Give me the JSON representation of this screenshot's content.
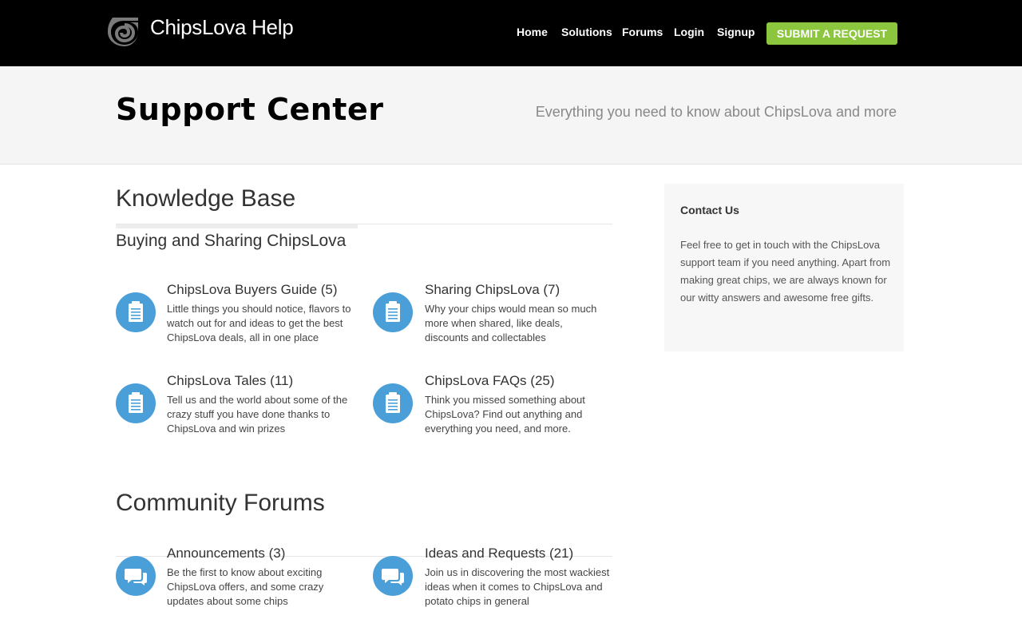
{
  "header": {
    "brand": "ChipsLova Help",
    "nav": [
      "Home",
      "Solutions",
      "Forums",
      "Login",
      "Signup"
    ],
    "submit_label": "SUBMIT A REQUEST",
    "accent_color": "#8cc63e"
  },
  "hero": {
    "title": "Support Center",
    "tagline": "Everything you need to know about ChipsLova and more"
  },
  "knowledge_base": {
    "title": "Knowledge Base",
    "category": "Buying and Sharing ChipsLova",
    "items": [
      {
        "title": "ChipsLova Buyers Guide (5)",
        "desc": "Little things you should notice, flavors to watch out for and ideas to get the best ChipsLova deals, all in one place",
        "icon": "clipboard-icon"
      },
      {
        "title": "Sharing ChipsLova (7)",
        "desc": "Why your chips would mean so much more when shared, like deals, discounts and collectables",
        "icon": "clipboard-icon"
      },
      {
        "title": "ChipsLova Tales (11)",
        "desc": "Tell us and the world about some of the crazy stuff you have done thanks to ChipsLova and win prizes",
        "icon": "clipboard-icon"
      },
      {
        "title": "ChipsLova FAQs (25)",
        "desc": "Think you missed something about ChipsLova? Find out anything and everything you need, and more.",
        "icon": "clipboard-icon"
      }
    ]
  },
  "forums": {
    "title": "Community Forums",
    "items": [
      {
        "title": "Announcements (3)",
        "desc": "Be the first to know about exciting ChipsLova offers, and some crazy updates about some chips",
        "icon": "chat-bubbles-icon"
      },
      {
        "title": "Ideas and Requests (21)",
        "desc": "Join us in discovering the most wackiest ideas when it comes to ChipsLova and potato chips in general",
        "icon": "chat-bubbles-icon"
      }
    ]
  },
  "sidebar": {
    "title": "Contact Us",
    "text": "Feel free to get in touch with the ChipsLova support team if you need anything. Apart from making great chips, we are always known for our witty answers and awesome free gifts."
  },
  "colors": {
    "icon_blue": "#4a9fd8",
    "header_bg": "#000000",
    "hero_bg": "#f5f5f5"
  }
}
